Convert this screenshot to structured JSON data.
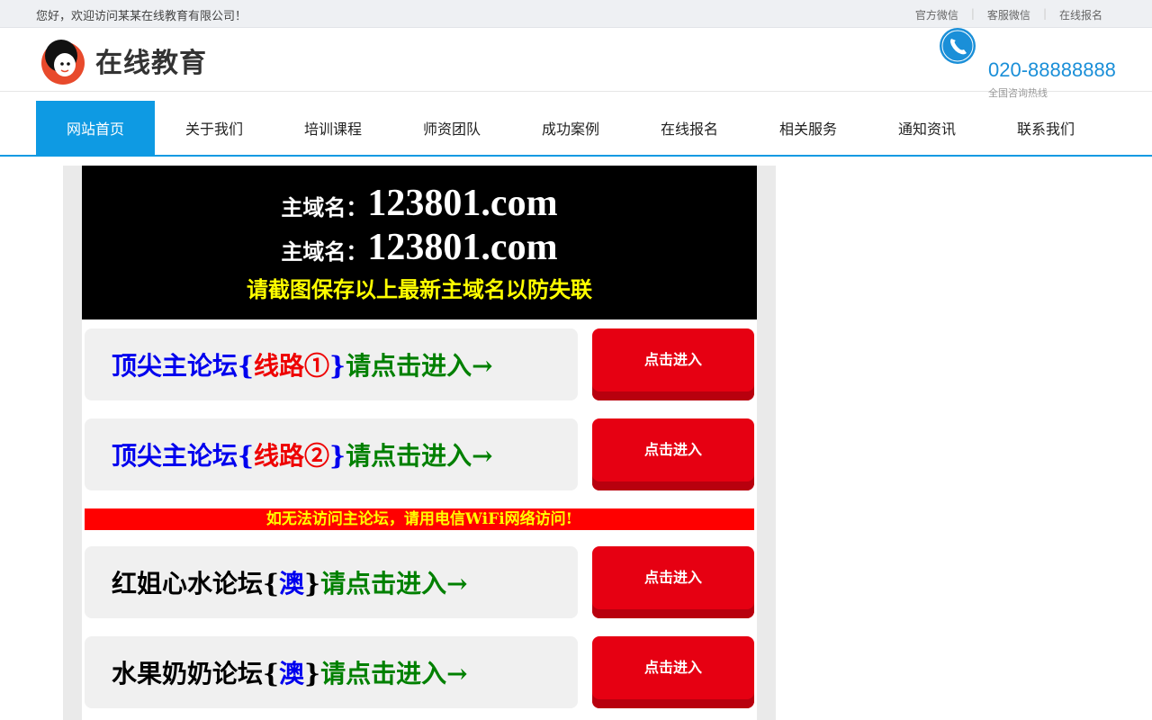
{
  "topbar": {
    "welcome": "您好，欢迎访问某某在线教育有限公司！",
    "links": [
      "官方微信",
      "客服微信",
      "在线报名"
    ]
  },
  "header": {
    "logo_text": "在线教育",
    "hotline": "020-88888888",
    "hotline_label": "全国咨询热线",
    "phone_icon": "phone-icon",
    "accent_color": "#0e9ae3"
  },
  "nav": {
    "items": [
      "网站首页",
      "关于我们",
      "培训课程",
      "师资团队",
      "成功案例",
      "在线报名",
      "相关服务",
      "通知资讯",
      "联系我们"
    ],
    "active_index": 0
  },
  "domain_box": {
    "line1_label": "主域名：",
    "line1_value": "123801.com",
    "line2_label": "主域名：",
    "line2_value": "123801.com",
    "note": "请截图保存以上最新主域名以防失联"
  },
  "entries": [
    {
      "p1": "顶尖主论坛",
      "p2": "{",
      "p3": "线路①",
      "p4": "}",
      "p5": "请点击进入",
      "p6": "→",
      "button": "点击进入"
    },
    {
      "p1": "顶尖主论坛",
      "p2": "{",
      "p3": "线路②",
      "p4": "}",
      "p5": "请点击进入",
      "p6": "→",
      "button": "点击进入"
    }
  ],
  "warning": "如无法访问主论坛，请用电信WiFi网络访问!",
  "entries2": [
    {
      "p1": "红姐心水论坛",
      "p2": "{",
      "p3": "澳",
      "p4": "}",
      "p5": "请点击进入",
      "p6": "→",
      "button": "点击进入"
    },
    {
      "p1": "水果奶奶论坛",
      "p2": "{",
      "p3": "澳",
      "p4": "}",
      "p5": "请点击进入",
      "p6": "→",
      "button": "点击进入"
    }
  ]
}
